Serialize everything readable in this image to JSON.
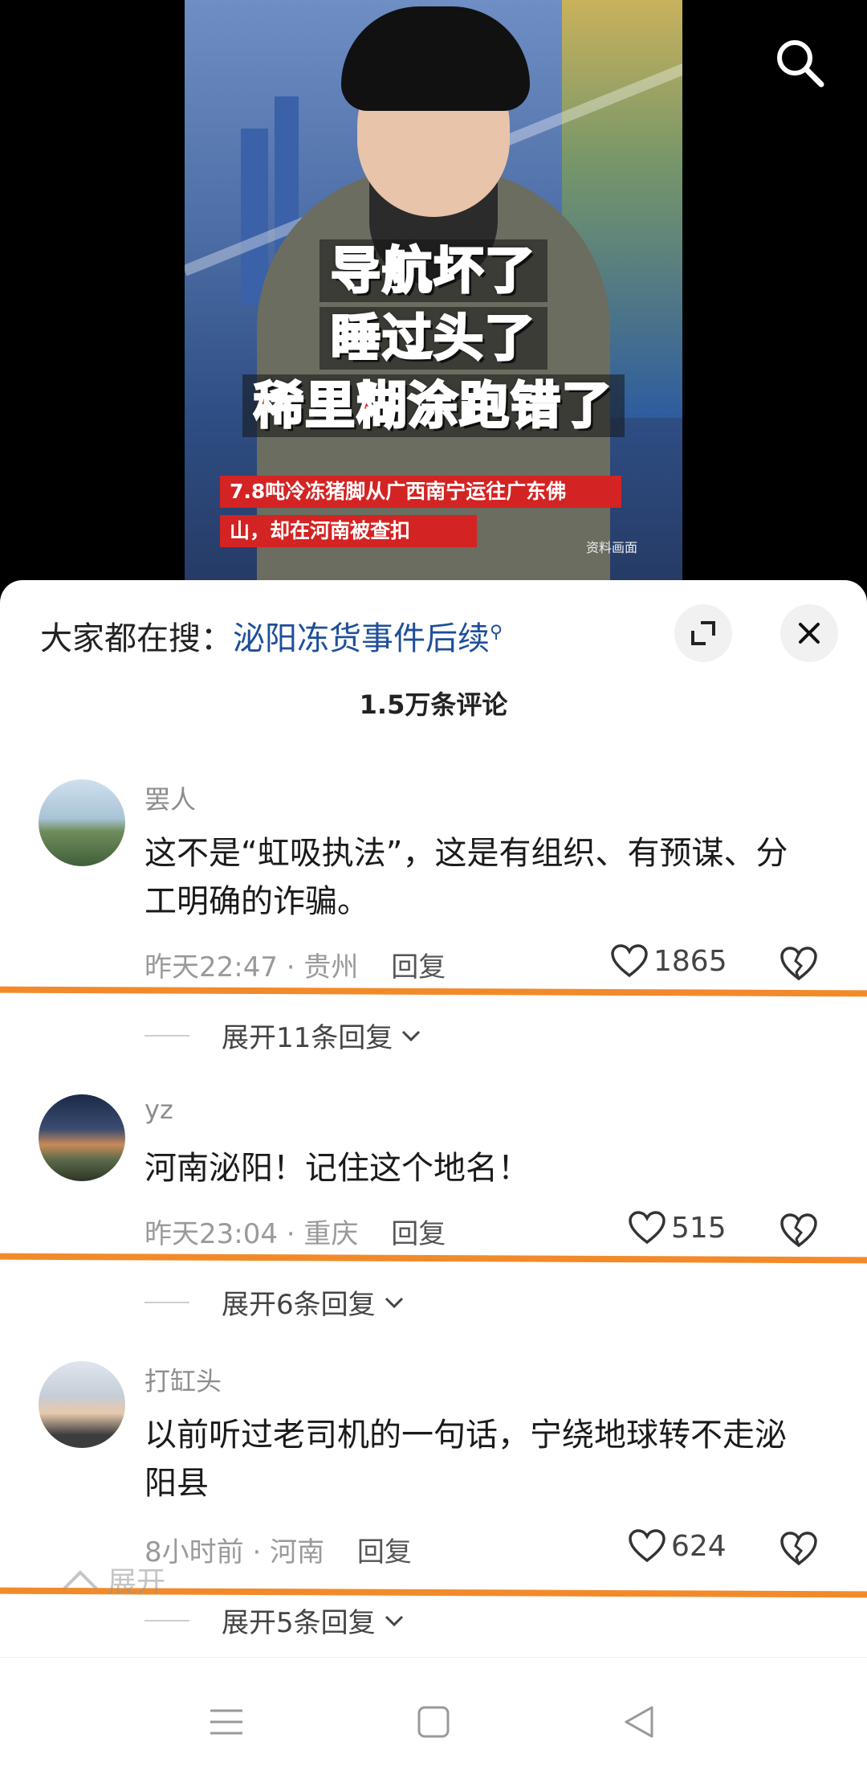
{
  "video": {
    "overlay_lines": [
      "导航坏了",
      "睡过头了",
      "稀里糊涂跑错了"
    ],
    "caption_line_1": "7.8吨冷冻猪脚从广西南宁运往广东佛",
    "caption_line_2": "山，却在河南被查扣",
    "watermark": "资料画面",
    "search_icon": "search-icon"
  },
  "sheet": {
    "suggest_prefix": "大家都在搜：",
    "suggest_term": "泌阳冻货事件后续",
    "comment_count": "1.5万条评论",
    "expand_icon": "fullscreen-icon",
    "close_icon": "close-icon"
  },
  "comments": [
    {
      "author": "罢人",
      "content": "这不是“虹吸执法”，这是有组织、有预谋、分工明确的诈骗。",
      "time": "昨天22:47",
      "location": "贵州",
      "reply_label": "回复",
      "likes": "1865",
      "more_replies": "展开11条回复"
    },
    {
      "author": "yz",
      "content": "河南泌阳！记住这个地名！",
      "time": "昨天23:04",
      "location": "重庆",
      "reply_label": "回复",
      "likes": "515",
      "more_replies": "展开6条回复"
    },
    {
      "author": "打缸头",
      "content": "以前听过老司机的一句话，宁绕地球转不走泌阳县",
      "time": "8小时前",
      "location": "河南",
      "reply_label": "回复",
      "likes": "624",
      "more_replies": "展开5条回复"
    }
  ],
  "collapse_label": "展开",
  "separator": "·",
  "colors": {
    "accent_link": "#1e4f9a",
    "highlight_line": "#f28a2a",
    "caption_red": "#d42323"
  },
  "nav": {
    "icons": [
      "menu-icon",
      "home-icon",
      "back-icon"
    ]
  }
}
